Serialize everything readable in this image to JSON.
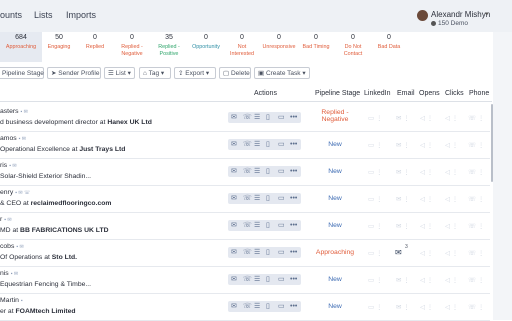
{
  "nav": {
    "links": [
      "ounts",
      "Lists",
      "Imports"
    ]
  },
  "user": {
    "name": "Alexandr Mishyn",
    "demo": "150 Demo"
  },
  "stages": [
    {
      "count": "684",
      "label": "Approaching",
      "color": "#e05c3a"
    },
    {
      "count": "50",
      "label": "Engaging",
      "color": "#e05c3a"
    },
    {
      "count": "0",
      "label": "Replied",
      "color": "#e05c3a"
    },
    {
      "count": "0",
      "label": "Replied - Negative",
      "color": "#e05c3a"
    },
    {
      "count": "35",
      "label": "Replied - Positive",
      "color": "#2fa56b"
    },
    {
      "count": "0",
      "label": "Opportunity",
      "color": "#2f8fa5"
    },
    {
      "count": "0",
      "label": "Not Interested",
      "color": "#e05c3a"
    },
    {
      "count": "0",
      "label": "Unresponsive",
      "color": "#e05c3a"
    },
    {
      "count": "0",
      "label": "Bad Timing",
      "color": "#e05c3a"
    },
    {
      "count": "0",
      "label": "Do Not Contact",
      "color": "#e05c3a"
    },
    {
      "count": "0",
      "label": "Bad Data",
      "color": "#e05c3a"
    }
  ],
  "toolbar": [
    "Pipeline Stage",
    "Sender Profile",
    "List",
    "Tag",
    "Export",
    "Delete",
    "Create Task"
  ],
  "headers": {
    "actions": "Actions",
    "stage": "Pipeline Stage",
    "linkedin": "LinkedIn",
    "email": "Email",
    "opens": "Opens",
    "clicks": "Clicks",
    "phone": "Phone"
  },
  "rows": [
    {
      "name": "asters",
      "pre": "d business development director at ",
      "company": "Hanex UK Ltd",
      "stage": "Replied - Negative",
      "stage_color": "#e05c3a"
    },
    {
      "name": "amos",
      "pre": "Operational Excellence at ",
      "company": "Just Trays Ltd",
      "stage": "New",
      "stage_color": "#3d6bb3"
    },
    {
      "name": "ris",
      "pre": "Solar-Shield Exterior Shadin...",
      "company": "",
      "stage": "New",
      "stage_color": "#3d6bb3"
    },
    {
      "name": "enry",
      "pre": "& CEO at ",
      "company": "reclaimedflooringco.com",
      "stage": "New",
      "stage_color": "#3d6bb3"
    },
    {
      "name": "r",
      "pre": "MD at ",
      "company": "BB FABRICATIONS UK LTD",
      "stage": "New",
      "stage_color": "#3d6bb3"
    },
    {
      "name": "cobs",
      "pre": "Of Operations at ",
      "company": "Sto Ltd.",
      "stage": "Approaching",
      "stage_color": "#e05c3a"
    },
    {
      "name": "nis",
      "pre": "Equestrian Fencing & Timbe...",
      "company": "",
      "stage": "New",
      "stage_color": "#3d6bb3"
    },
    {
      "name": "Martin",
      "pre": "er at ",
      "company": "FOAMtech Limited",
      "stage": "New",
      "stage_color": "#3d6bb3"
    }
  ],
  "email_count": "3"
}
